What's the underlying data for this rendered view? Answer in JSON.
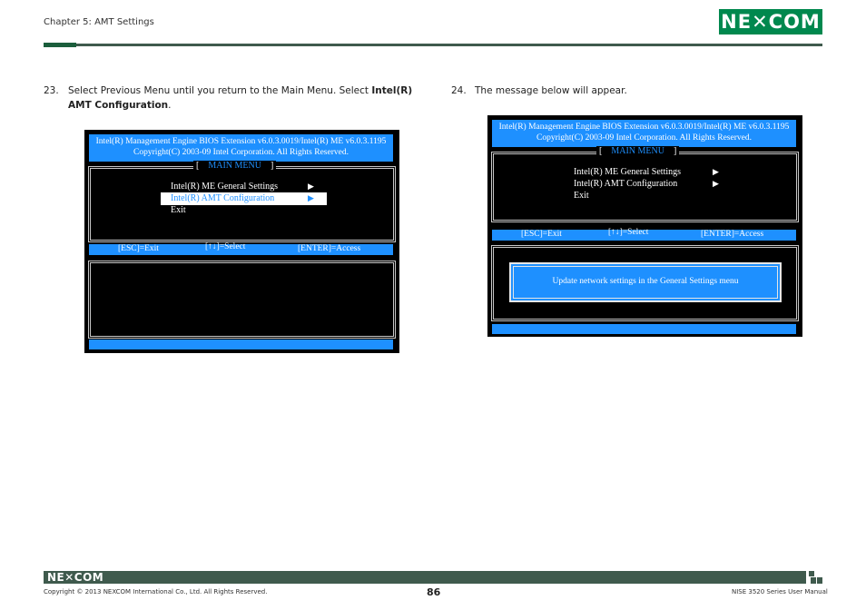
{
  "header": {
    "chapter": "Chapter 5: AMT Settings",
    "logo": "NE✕COM"
  },
  "step23": {
    "number": "23.",
    "text_pre": "Select Previous Menu until you return to the Main Menu. Select ",
    "text_bold1": "Intel(R)",
    "text_bold2": "AMT Configuration",
    "text_post": "."
  },
  "step24": {
    "number": "24.",
    "text": "The message below will appear."
  },
  "screen1": {
    "title_line1": "Intel(R) Management Engine BIOS Extension v6.0.3.0019/Intel(R) ME v6.0.3.1195",
    "title_line2": "Copyright(C) 2003-09 Intel Corporation. All Rights Reserved.",
    "menu_open": "[",
    "menu_title": "MAIN MENU",
    "menu_close": "]",
    "items": [
      {
        "label": "Intel(R) ME General Settings",
        "arrow": "▶"
      },
      {
        "label": "Intel(R) AMT Configuration",
        "arrow": "▶"
      },
      {
        "label": "Exit",
        "arrow": ""
      }
    ],
    "status": {
      "esc": "[ESC]=Exit",
      "select": "[↑↓]=Select",
      "enter": "[ENTER]=Access"
    }
  },
  "screen2": {
    "title_line1": "Intel(R) Management Engine BIOS Extension v6.0.3.0019/Intel(R) ME v6.0.3.1195",
    "title_line2": "Copyright(C) 2003-09 Intel Corporation. All Rights Reserved.",
    "menu_open": "[",
    "menu_title": "MAIN MENU",
    "menu_close": "]",
    "items": [
      {
        "label": "Intel(R) ME General Settings",
        "arrow": "▶"
      },
      {
        "label": "Intel(R) AMT Configuration",
        "arrow": "▶"
      },
      {
        "label": "Exit",
        "arrow": ""
      }
    ],
    "status": {
      "esc": "[ESC]=Exit",
      "select": "[↑↓]=Select",
      "enter": "[ENTER]=Access"
    },
    "message": "Update network settings in the General Settings menu"
  },
  "footer": {
    "logo": "NE✕COM",
    "copyright": "Copyright © 2013 NEXCOM International Co., Ltd. All Rights Reserved.",
    "page": "86",
    "manual": "NISE 3520 Series User Manual"
  },
  "colors": {
    "bios_blue": "#1e90ff",
    "brand_green": "#00884e",
    "rule_dark": "#3f5a4d"
  }
}
